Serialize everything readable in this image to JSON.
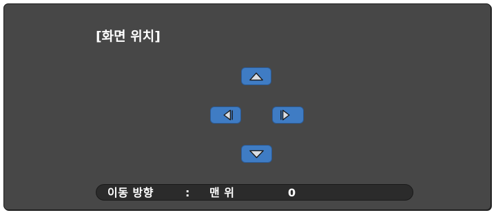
{
  "window": {
    "title": "[화면 위치]"
  },
  "controls": {
    "up_icon": "triangle-up",
    "left_icon": "triangle-left",
    "right_icon": "triangle-right",
    "down_icon": "triangle-down",
    "button_color": "#3f7cc4",
    "panel_color": "#474747"
  },
  "status": {
    "label": "이동 방향",
    "separator": ":",
    "direction": "맨 위",
    "value": "0"
  }
}
